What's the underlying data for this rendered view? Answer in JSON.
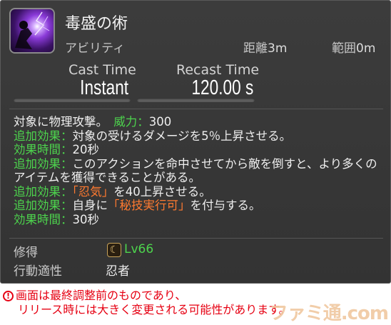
{
  "action": {
    "name": "毒盛の術",
    "type": "アビリティ",
    "range_label": "距離",
    "range_value": "3m",
    "radius_label": "範囲",
    "radius_value": "0m",
    "cast_label": "Cast Time",
    "cast_value": "Instant",
    "recast_label": "Recast Time",
    "recast_value": "120.00 s",
    "icon": "ninjutsu-purple-lightning-icon"
  },
  "description": {
    "l1_text": "対象に物理攻撃。",
    "l1_potency_label": "威力",
    "l1_potency_sep": "：",
    "l1_potency_value": "300",
    "l2_label": "追加効果",
    "l2_sep": "：",
    "l2_text": "対象の受けるダメージを5％上昇させる。",
    "l3_label": "効果時間",
    "l3_sep": "：",
    "l3_text": "20秒",
    "l4_label": "追加効果",
    "l4_sep": "：",
    "l4_text": "このアクションを命中させてから敵を倒すと、より多くの",
    "l5_text": "アイテムを獲得できることがある。",
    "l6_label": "追加効果",
    "l6_sep": "：",
    "l6_highlight": "「忍気」",
    "l6_text": "を40上昇させる。",
    "l7_label": "追加効果",
    "l7_sep": "：",
    "l7_pre": "自身に",
    "l7_highlight": "「秘技実行可」",
    "l7_text": "を付与する。",
    "l8_label": "効果時間",
    "l8_sep": "：",
    "l8_text": "30秒"
  },
  "meta": {
    "acquired_label": "修得",
    "level_icon": "job-level-icon",
    "level": "Lv66",
    "affinity_label": "行動適性",
    "affinity_value": "忍者"
  },
  "notice": {
    "icon": "!",
    "line1": "画面は最終調整前のものであり、",
    "line2": "リリース時には大きく変更される可能性があります。"
  },
  "watermark": "ファミ通.com",
  "colors": {
    "accent_green": "#4dd44d",
    "highlight_orange": "#ff7a30",
    "notice_red": "#e60012",
    "panel_bg": "#383838"
  }
}
